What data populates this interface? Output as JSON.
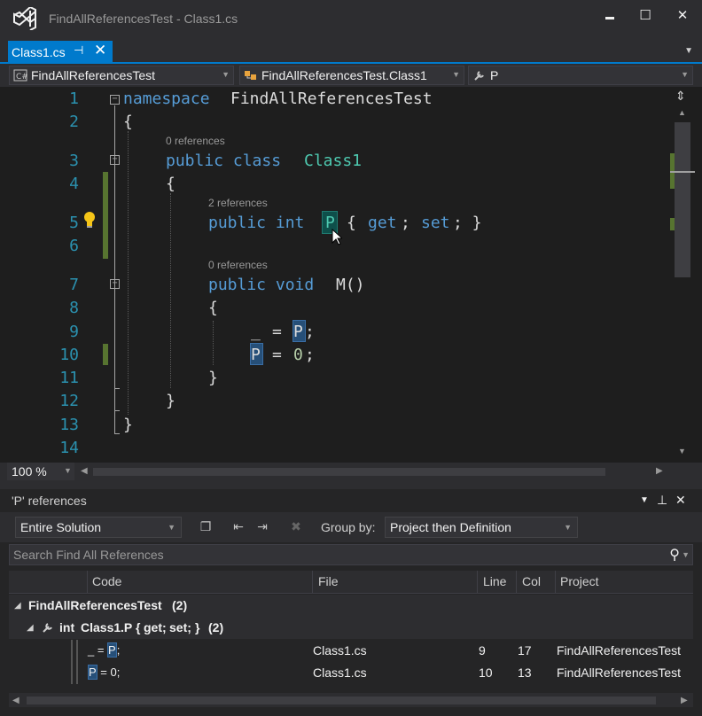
{
  "window": {
    "title": "FindAllReferencesTest - Class1.cs",
    "minimize": "▬",
    "maximize": "☐",
    "close": "✕"
  },
  "doc_tab": {
    "label": "Class1.cs",
    "pin": "⊣",
    "close": "✕"
  },
  "navbar": {
    "project": "FindAllReferencesTest",
    "type": "FindAllReferencesTest.Class1",
    "member": "P"
  },
  "editor": {
    "line_numbers": [
      "1",
      "2",
      "3",
      "4",
      "5",
      "6",
      "7",
      "8",
      "9",
      "10",
      "11",
      "12",
      "13",
      "14"
    ],
    "lens": [
      "0 references",
      "2 references",
      "0 references"
    ],
    "code": {
      "l1_kw": "namespace",
      "l1_name": "FindAllReferencesTest",
      "brace_open": "{",
      "brace_close": "}",
      "l3_kw": "public class",
      "l3_cls": "Class1",
      "l5_kw": "public int",
      "l5_name": "P",
      "l5_open": "{",
      "l5_get": "get",
      "l5_semi1": ";",
      "l5_set": "set",
      "l5_close": "; }",
      "l7_kw": "public void",
      "l7_name": "M()",
      "l9_discard": "_",
      "l9_eq": "=",
      "l9_ref": "P",
      "l9_semi": ";",
      "l10_ref": "P",
      "l10_eq": "=",
      "l10_num": "0",
      "l10_semi": ";"
    }
  },
  "zoom": "100 %",
  "panel": {
    "title": "'P' references",
    "scope": "Entire Solution",
    "group_by_label": "Group by:",
    "group_by_value": "Project then Definition",
    "search_placeholder": "Search Find All References",
    "columns": [
      "Code",
      "File",
      "Line",
      "Col",
      "Project"
    ],
    "group1": {
      "label": "FindAllReferencesTest",
      "count": "(2)"
    },
    "group2": {
      "kw1": "int",
      "cls": "Class1",
      "dot_p": ".P",
      "open": "{",
      "get": "get;",
      "set": "set;",
      "close": "}",
      "count": "(2)"
    },
    "rows": [
      {
        "code_pre": "_ = ",
        "code_ref": "P",
        "code_post": ";",
        "file": "Class1.cs",
        "line": "9",
        "col": "17",
        "project": "FindAllReferencesTest"
      },
      {
        "code_pre": "",
        "code_ref": "P",
        "code_post": " = 0;",
        "file": "Class1.cs",
        "line": "10",
        "col": "13",
        "project": "FindAllReferencesTest"
      }
    ]
  },
  "colors": {
    "accent": "#007acc",
    "keyword": "#569cd6",
    "type": "#4ec9b0",
    "line_number": "#2b91af",
    "change_bar": "#577430"
  }
}
